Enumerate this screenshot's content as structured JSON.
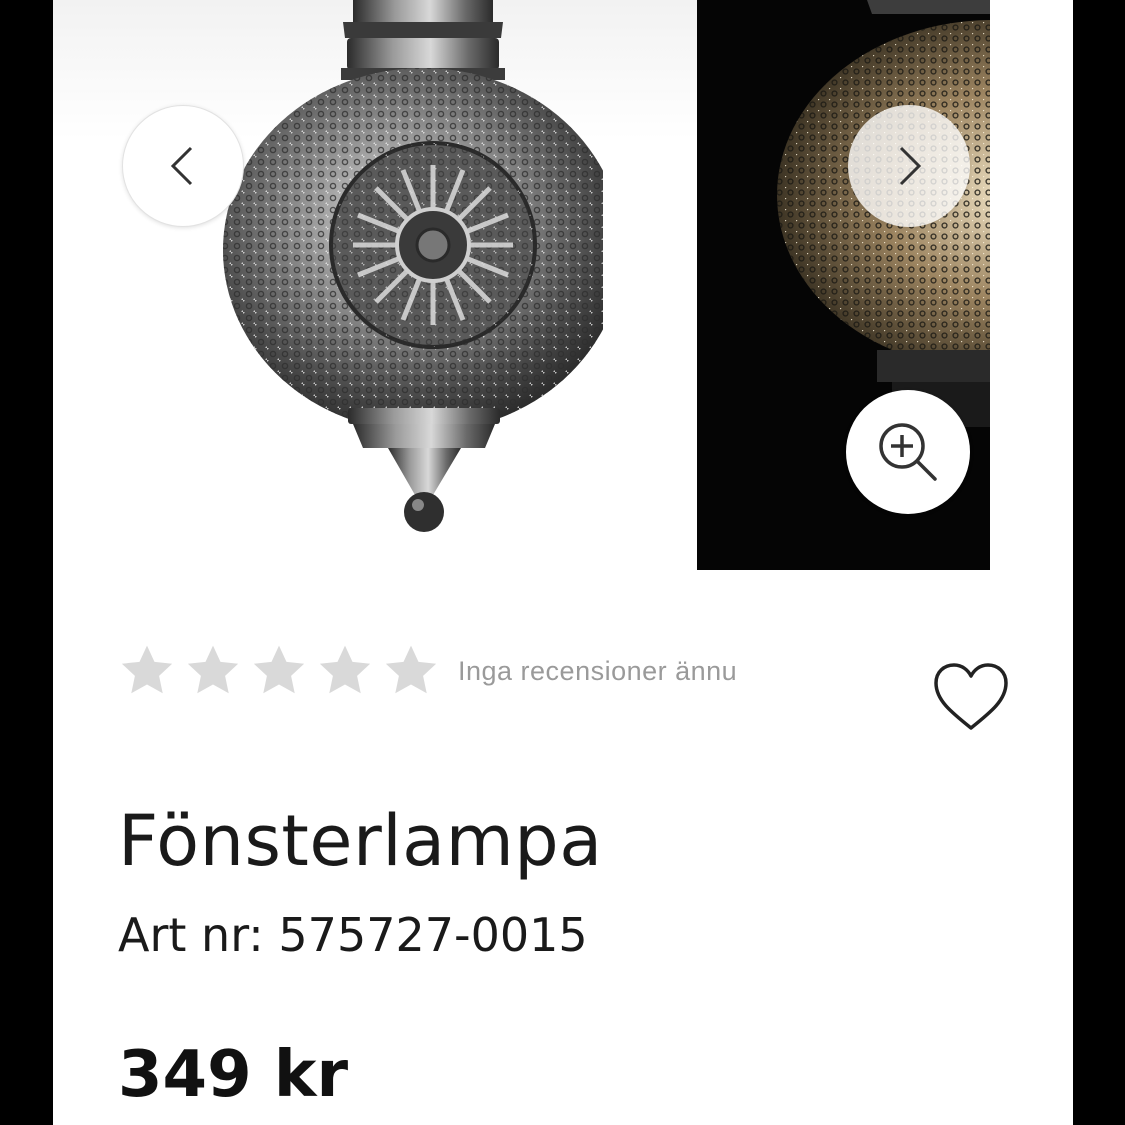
{
  "gallery": {
    "images": [
      {
        "name": "lamp-daylight",
        "background": "#ffffff"
      },
      {
        "name": "lamp-lit",
        "background": "#050505"
      }
    ],
    "prev_icon": "chevron-left-icon",
    "next_icon": "chevron-right-icon",
    "zoom_icon": "zoom-in-icon"
  },
  "rating": {
    "stars": 5,
    "filled": 0,
    "star_color": "#d9d9d9",
    "text": "Inga recensioner ännu"
  },
  "wishlist": {
    "icon": "heart-icon"
  },
  "product": {
    "title": "Fönsterlampa",
    "article_number": "Art nr: 575727-0015",
    "price": "349 kr"
  }
}
